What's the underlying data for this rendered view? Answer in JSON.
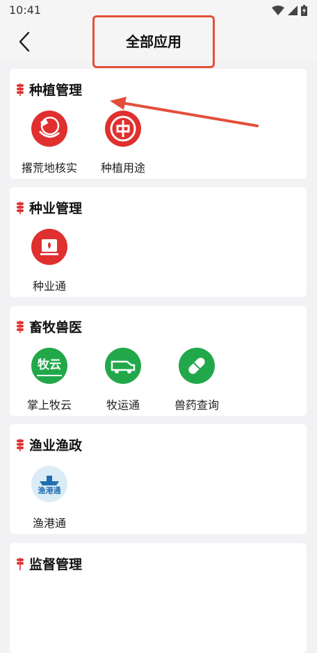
{
  "status": {
    "time": "10:41"
  },
  "header": {
    "title": "全部应用"
  },
  "sections": [
    {
      "title": "种植管理",
      "apps": [
        {
          "label": "撂荒地核实",
          "icon": "land-survey-icon"
        },
        {
          "label": "种植用途",
          "icon": "planting-use-icon"
        }
      ]
    },
    {
      "title": "种业管理",
      "apps": [
        {
          "label": "种业通",
          "icon": "seed-industry-icon"
        }
      ]
    },
    {
      "title": "畜牧兽医",
      "apps": [
        {
          "label": "掌上牧云",
          "icon": "muyun-icon",
          "icon_text": "牧云"
        },
        {
          "label": "牧运通",
          "icon": "livestock-transport-icon"
        },
        {
          "label": "兽药查询",
          "icon": "vet-drug-icon"
        }
      ]
    },
    {
      "title": "渔业渔政",
      "apps": [
        {
          "label": "渔港通",
          "icon": "fishing-port-icon",
          "icon_text": "渔港通"
        }
      ]
    },
    {
      "title": "监督管理"
    }
  ],
  "colors": {
    "red": "#e02f2f",
    "green": "#22a84a",
    "annotation": "#e2503a"
  }
}
